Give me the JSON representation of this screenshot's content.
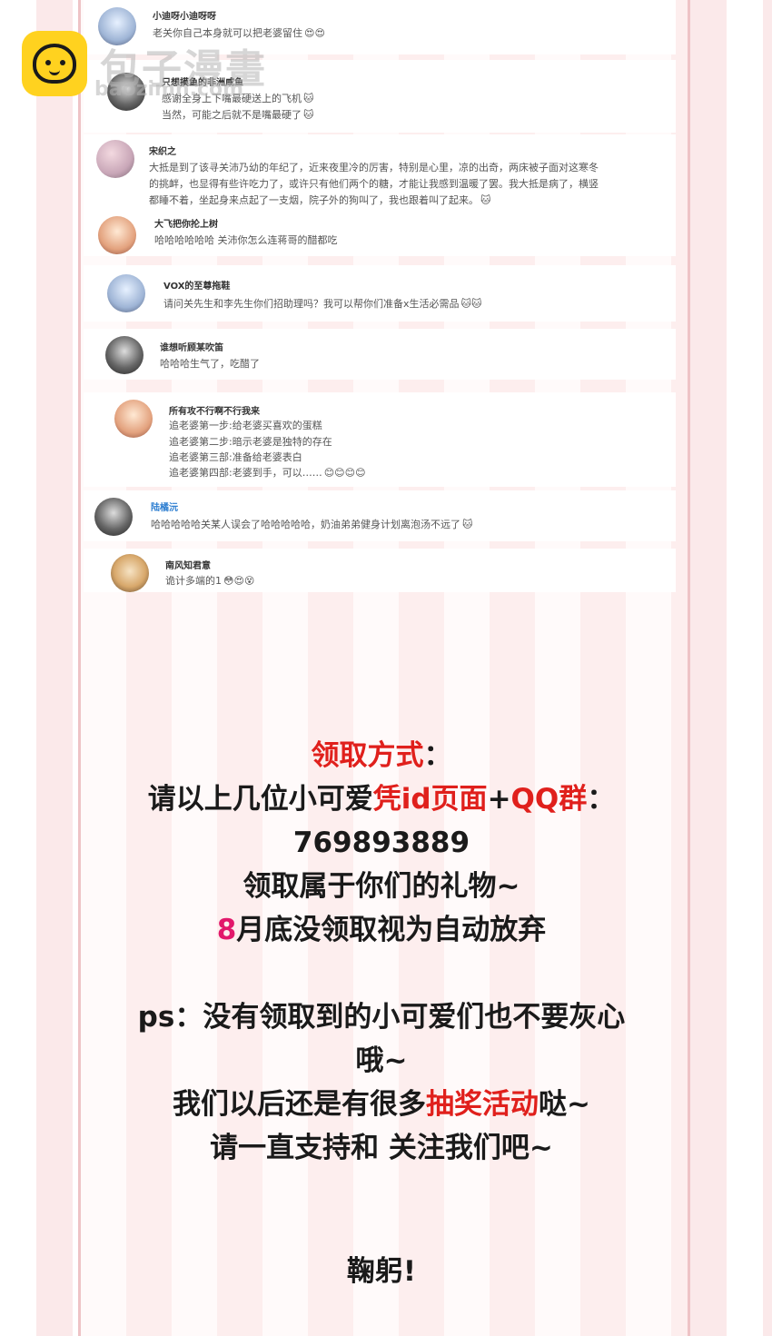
{
  "watermark": {
    "title": "包子漫畫",
    "subtitle": "baozimh.com",
    "logo_icon": "bun-face-icon"
  },
  "comments": [
    {
      "name": "小迪呀小迪呀呀",
      "lines": [
        "老关你自己本身就可以把老婆留住"
      ],
      "emoji": "😍😍"
    },
    {
      "name": "只想摸鱼的非洲咸鱼",
      "lines": [
        "感谢全身上下嘴最硬送上的飞机",
        "当然，可能之后就不是嘴最硬了"
      ],
      "emoji_lines": [
        "🐱",
        "🐱"
      ]
    },
    {
      "name": "宋织之",
      "lines": [
        "大抵是到了该寻关沛乃幼的年纪了，近来夜里冷的厉害，特别是心里，凉的出奇，两床被子面对这寒冬",
        "的挑衅，也显得有些许吃力了，或许只有他们两个的糖，才能让我感到温暖了罢。我大抵是病了，横竖",
        "都睡不着，坐起身来点起了一支烟，院子外的狗叫了，我也跟着叫了起来。"
      ],
      "emoji": "🐱"
    },
    {
      "name": "大飞把你抡上树",
      "lines": [
        "哈哈哈哈哈哈 关沛你怎么连蒋哥的醋都吃"
      ]
    },
    {
      "name": "VOX的至尊拖鞋",
      "lines": [
        "请问关先生和李先生你们招助理吗？我可以帮你们准备x生活必需品"
      ],
      "emoji": "🐱🐱"
    },
    {
      "name": "谁想听顾某吹笛",
      "lines": [
        "哈哈哈生气了，吃醋了"
      ]
    },
    {
      "name": "所有攻不行啊不行我来",
      "lines": [
        "追老婆第一步:给老婆买喜欢的蛋糕",
        "追老婆第二步:暗示老婆是独特的存在",
        "追老婆第三部:准备给老婆表白",
        "追老婆第四部:老婆到手，可以……"
      ],
      "emoji": "😊😊😊😊"
    },
    {
      "name": "陆橘沅",
      "lines": [
        "哈哈哈哈哈关某人误会了哈哈哈哈哈，奶油弟弟健身计划离泡汤不远了"
      ],
      "emoji": "🐱"
    },
    {
      "name": "南风知君意",
      "lines": [
        "诡计多端的1"
      ],
      "emoji": "😳😍😵"
    }
  ],
  "notice": {
    "l1_red": "领取方式",
    "l1_black": "：",
    "l2_black": "请以上几位小可爱",
    "l2_red1": "凭id页面",
    "l2_black2": "+",
    "l2_red2": "QQ群",
    "l2_black3": "：",
    "l3": "769893889",
    "l4": "领取属于你们的礼物~",
    "l5_pink": "8",
    "l5_black": "月底没领取视为自动放弃",
    "l6": "ps：没有领取到的小可爱们也不要灰心",
    "l7": "哦~",
    "l8_black1": "我们以后还是有很多",
    "l8_red": "抽奖活动",
    "l8_black2": "哒~",
    "l9": "请一直支持和 关注我们吧~",
    "l10": "鞠躬!"
  }
}
